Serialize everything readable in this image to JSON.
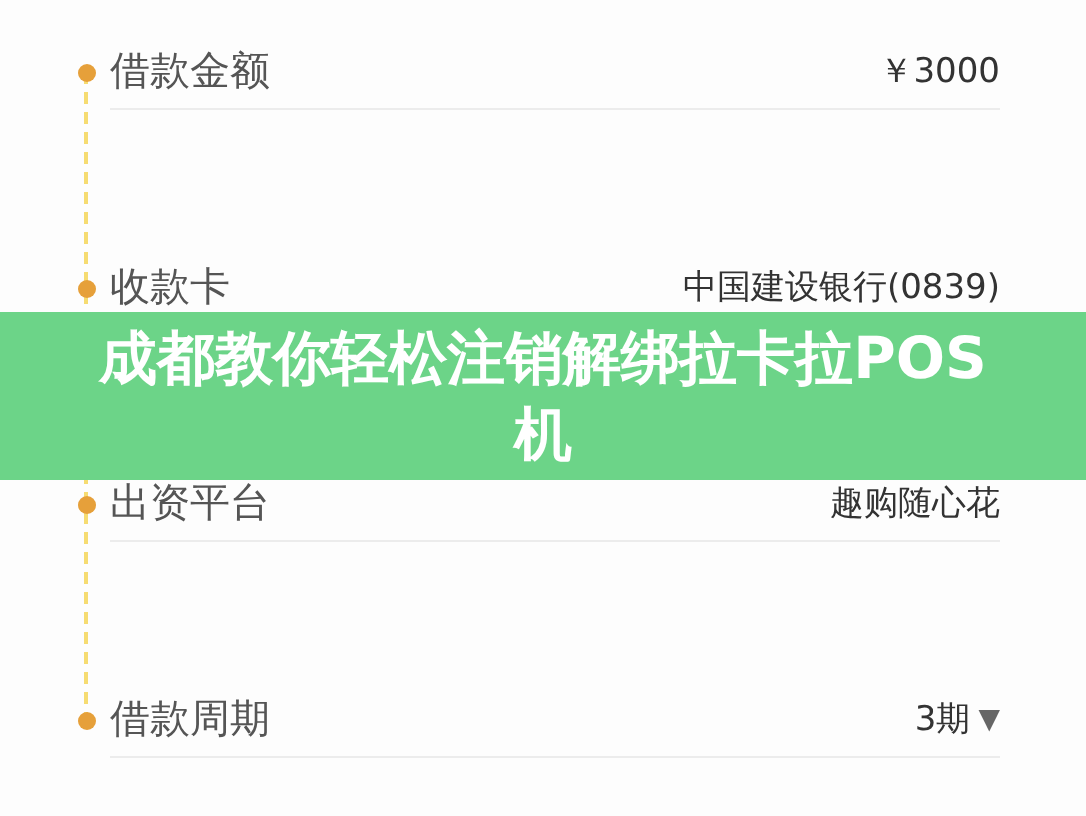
{
  "rows": [
    {
      "label": "借款金额",
      "value": "￥3000"
    },
    {
      "label": "收款卡",
      "value": "中国建设银行(0839)"
    },
    {
      "label": "出资平台",
      "value": "趣购随心花"
    },
    {
      "label": "借款周期",
      "value": "3期",
      "caret": "▼"
    }
  ],
  "banner": {
    "title": "成都教你轻松注销解绑拉卡拉POS机"
  }
}
